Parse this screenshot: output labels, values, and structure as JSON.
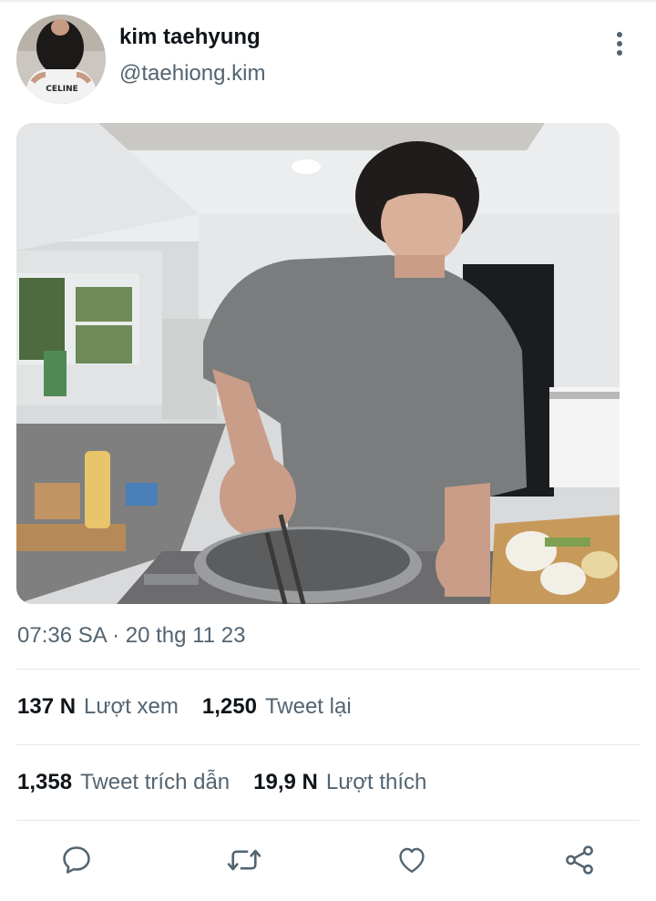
{
  "tweet": {
    "author_name": "kim taehyung",
    "author_handle": "@taehiong.kim",
    "avatar_shirt_text": "CELINE",
    "timestamp": "07:36 SA · 20 thg 11 23"
  },
  "stats": {
    "views": {
      "value": "137 N",
      "label": "Lượt xem"
    },
    "retweets": {
      "value": "1,250",
      "label": "Tweet lại"
    },
    "quotes": {
      "value": "1,358",
      "label": "Tweet trích dẫn"
    },
    "likes": {
      "value": "19,9 N",
      "label": "Lượt thích"
    }
  },
  "icons": {
    "more": "more-vertical-icon",
    "reply": "reply-icon",
    "retweet": "retweet-icon",
    "like": "heart-icon",
    "share": "share-icon"
  },
  "colors": {
    "text_primary": "#0f1419",
    "text_secondary": "#536471",
    "icon": "#536471",
    "divider": "#e3e7ea"
  }
}
